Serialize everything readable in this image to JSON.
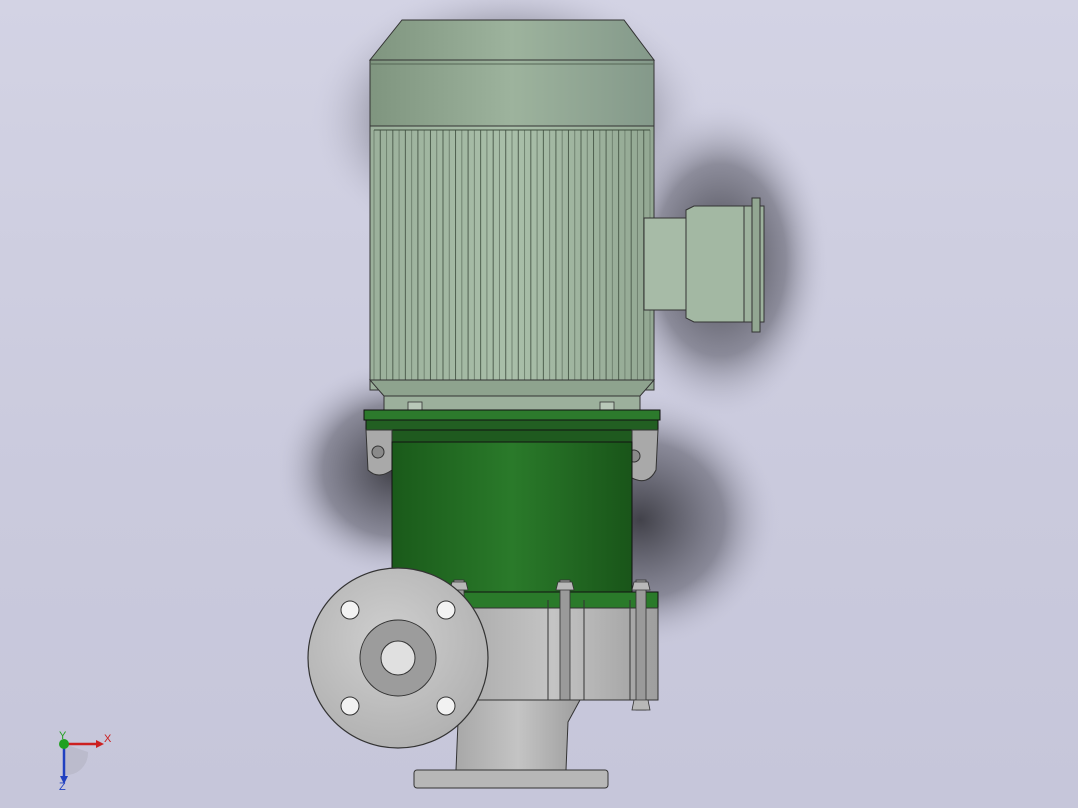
{
  "viewport": {
    "background_top": "#d3d3e4",
    "background_bottom": "#c6c6da"
  },
  "model": {
    "motor_fan_cover_color": "#8fa58f",
    "motor_body_color": "#9bb39b",
    "adapter_color": "#1f6b1f",
    "pump_casing_color": "#b9b9b9"
  },
  "triad": {
    "x_label": "X",
    "y_label": "Y",
    "z_label": "Z",
    "x_color": "#cc2020",
    "y_color": "#20a020",
    "z_color": "#2040c0"
  }
}
